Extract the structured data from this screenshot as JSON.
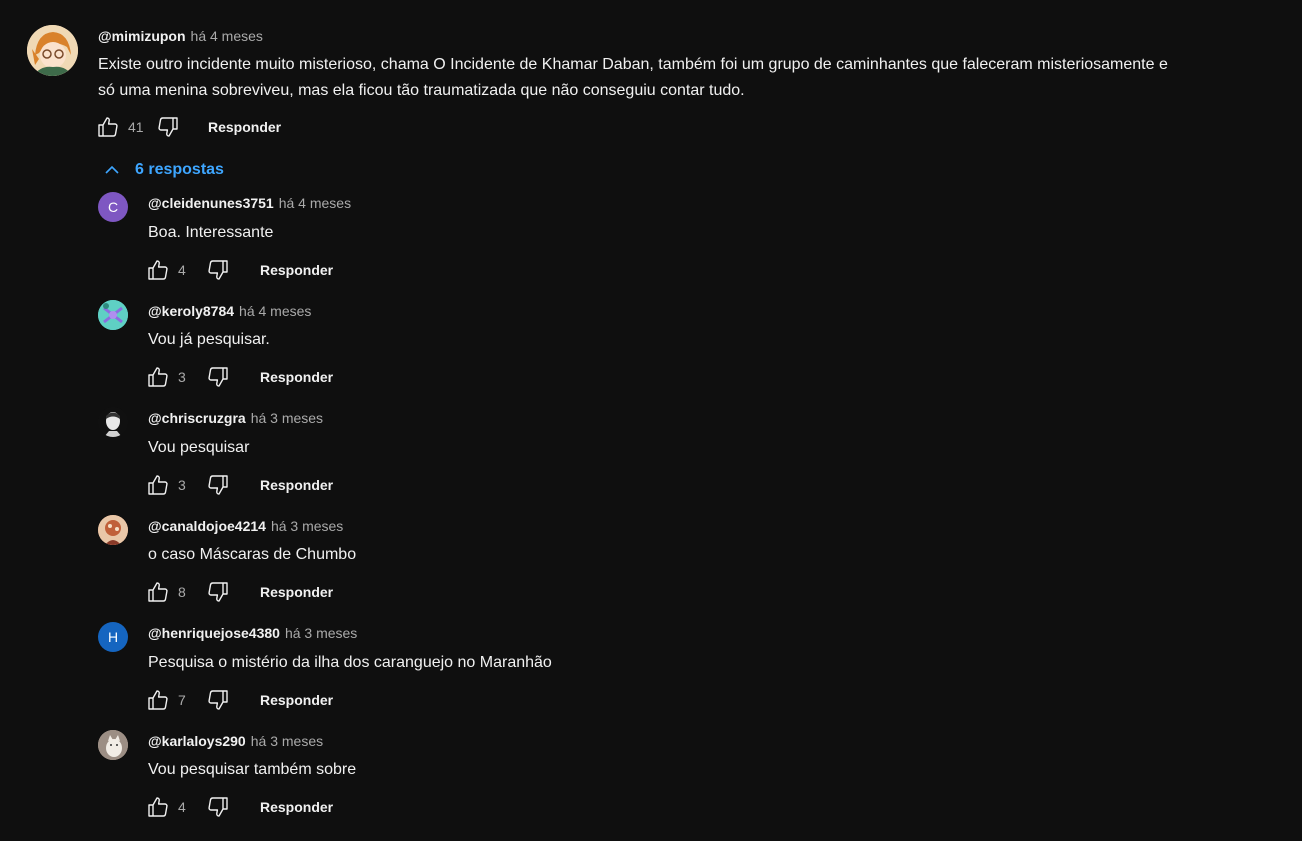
{
  "colors": {
    "background": "#0f0f0f",
    "link": "#3ea6ff",
    "muted": "#aaaaaa"
  },
  "top_comment": {
    "author": "@mimizupon",
    "time": "há 4 meses",
    "text_line1": "Existe outro incidente muito misterioso, chama O Incidente de Khamar Daban, também foi um grupo de caminhantes que faleceram misteriosamente e",
    "text_line2": "só uma menina sobreviveu, mas ela ficou tão traumatizada que não conseguiu contar tudo.",
    "likes": "41",
    "reply_label": "Responder",
    "avatar_icon": "anime-avatar-icon"
  },
  "replies_toggle": {
    "label": "6 respostas",
    "icon": "chevron-up-icon"
  },
  "replies": [
    {
      "author": "@cleidenunes3751",
      "time": "há 4 meses",
      "text": "Boa. Interessante",
      "likes": "4",
      "reply_label": "Responder",
      "avatar_letter": "C",
      "avatar_color": "#7e57c2"
    },
    {
      "author": "@keroly8784",
      "time": "há 4 meses",
      "text": "Vou já pesquisar.",
      "likes": "3",
      "reply_label": "Responder",
      "avatar_color": "#4fc3c0"
    },
    {
      "author": "@chriscruzgra",
      "time": "há 3 meses",
      "text": "Vou pesquisar",
      "likes": "3",
      "reply_label": "Responder",
      "avatar_color": "#111111"
    },
    {
      "author": "@canaldojoe4214",
      "time": "há 3 meses",
      "text": "o caso Máscaras de Chumbo",
      "likes": "8",
      "reply_label": "Responder",
      "avatar_color": "#c8805a"
    },
    {
      "author": "@henriquejose4380",
      "time": "há 3 meses",
      "text": "Pesquisa o mistério da ilha dos caranguejo no Maranhão",
      "likes": "7",
      "reply_label": "Responder",
      "avatar_letter": "H",
      "avatar_color": "#1565c0"
    },
    {
      "author": "@karlaloys290",
      "time": "há 3 meses",
      "text": "Vou pesquisar também sobre",
      "likes": "4",
      "reply_label": "Responder",
      "avatar_color": "#b8a79a"
    }
  ]
}
